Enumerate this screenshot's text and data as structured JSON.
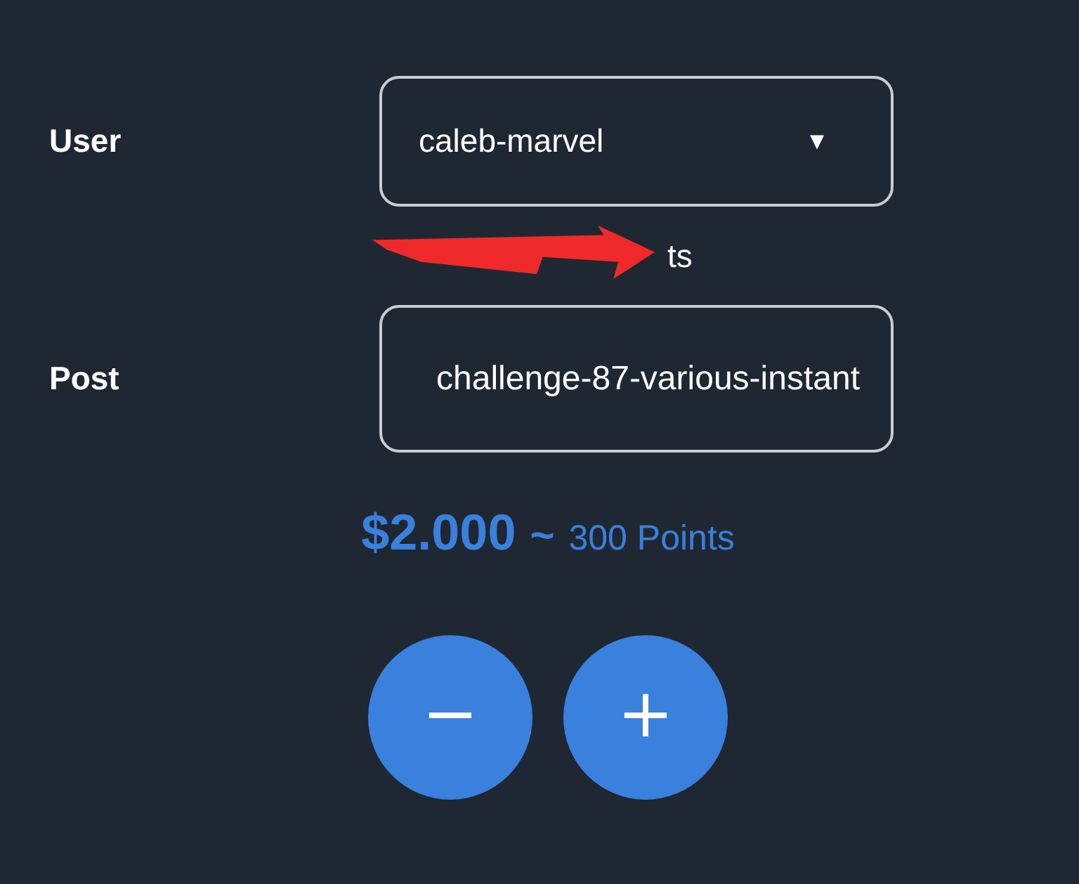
{
  "user": {
    "label": "User",
    "value": "caleb-marvel",
    "caret": "▼"
  },
  "hint": {
    "text": "ts",
    "redacted": true
  },
  "post": {
    "label": "Post",
    "value": "challenge-87-various-instant"
  },
  "amount": {
    "value": "$2.000",
    "separator": "~",
    "points": "300 Points"
  },
  "buttons": [
    {
      "symbol": "−"
    },
    {
      "symbol": "+"
    }
  ]
}
